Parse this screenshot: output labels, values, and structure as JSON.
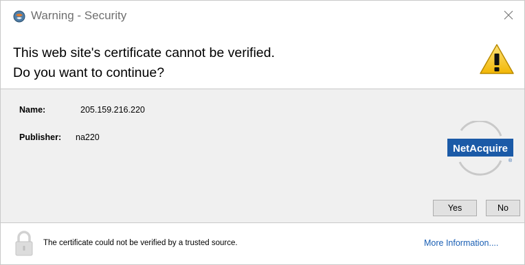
{
  "window": {
    "title": "Warning - Security",
    "app_icon": "java-coffee-cup-icon",
    "close_icon": "close-icon"
  },
  "header": {
    "line1": "This web site's certificate cannot be verified.",
    "line2": "Do you want to continue?",
    "icon": "warning-triangle-icon"
  },
  "details": {
    "name_label": "Name:",
    "name_value": "205.159.216.220",
    "publisher_label": "Publisher:",
    "publisher_value": "na220",
    "logo_text": "NetAcquire",
    "logo_mark": "®"
  },
  "buttons": {
    "yes_label": "Yes",
    "no_label": "No"
  },
  "footer": {
    "message": "The certificate could not be verified by a trusted source.",
    "more_info": "More Information....",
    "icon": "lock-icon"
  },
  "colors": {
    "body_background": "#f0f0f0",
    "link": "#1a5fb4",
    "logo_blue": "#1b5aa7",
    "warning_yellow": "#f7c21a"
  }
}
